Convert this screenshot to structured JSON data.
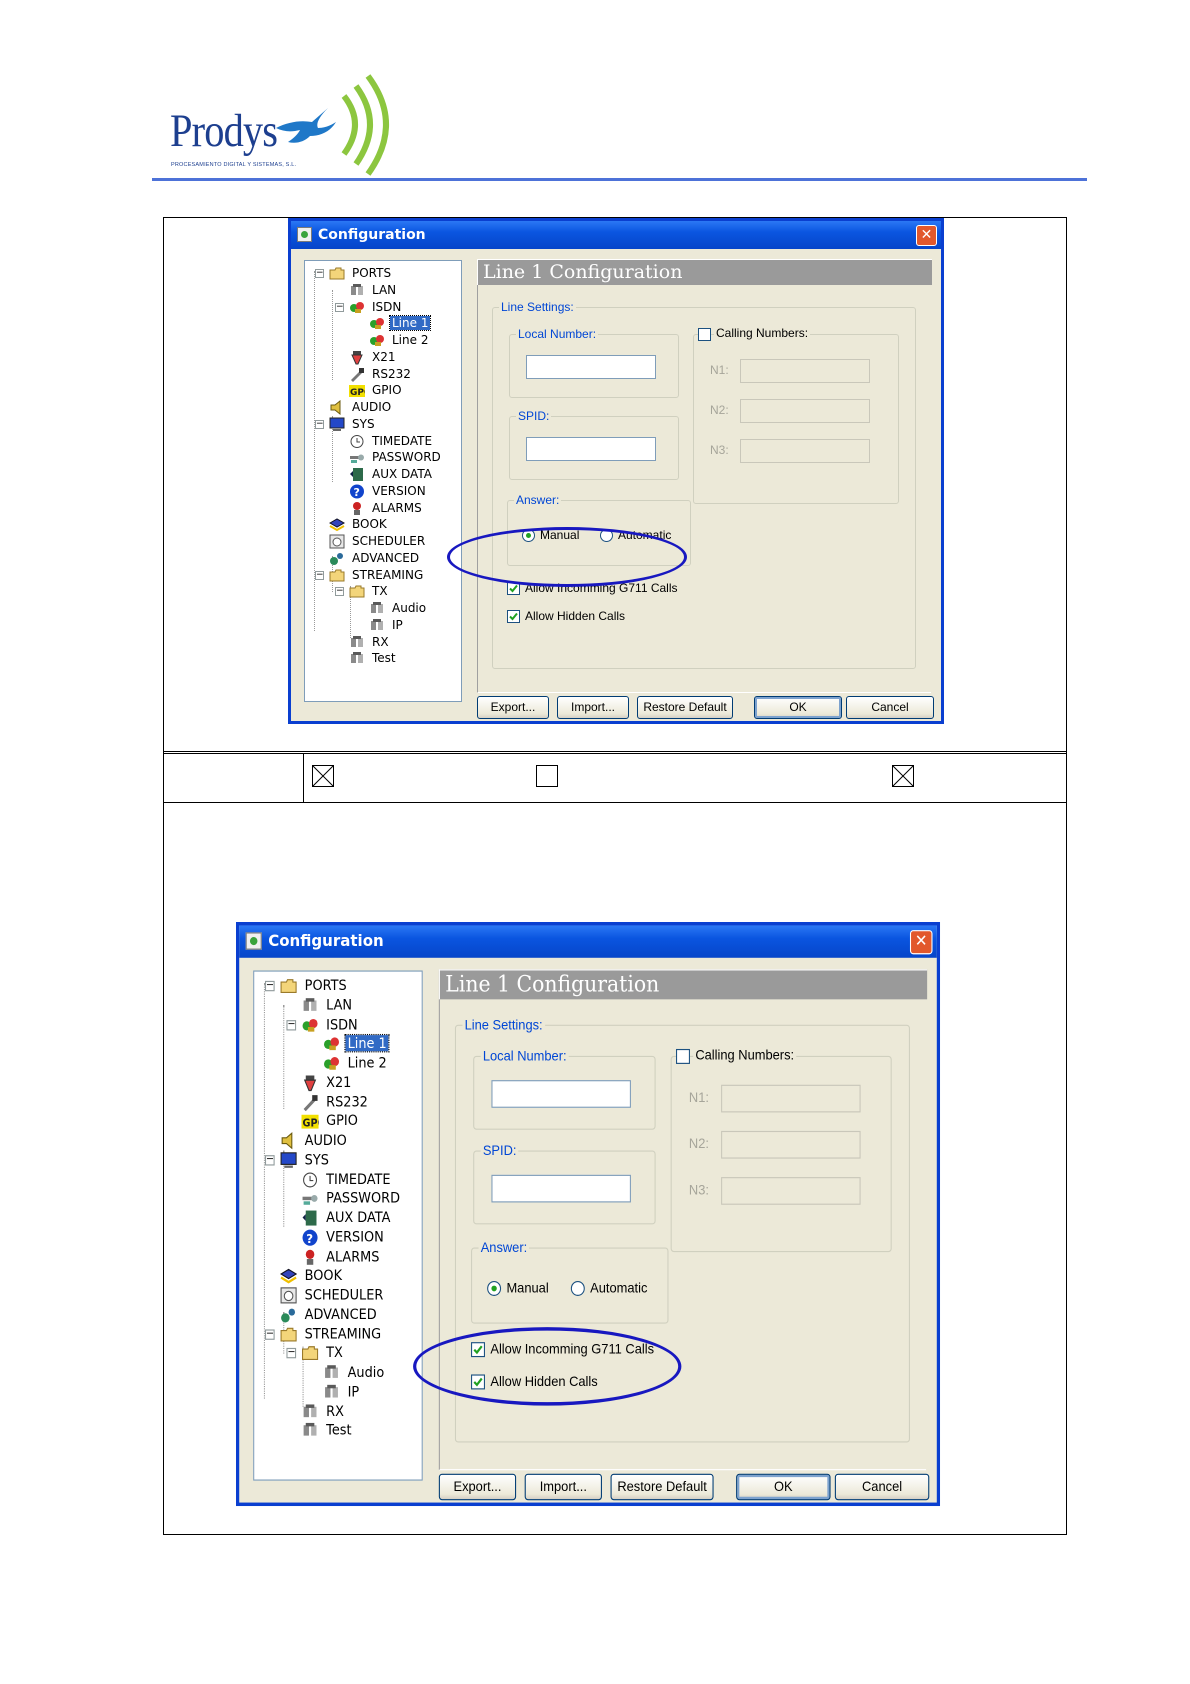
{
  "logo": {
    "name": "Prodys",
    "tagline": "PROCESAMIENTO DIGITAL Y SISTEMAS, S.L."
  },
  "colors": {
    "accent_rule": "#4d72d8",
    "title_bar": "#0a55e0",
    "highlight_ellipse": "#1818c0"
  },
  "checkbox_row": [
    {
      "checked": true
    },
    {
      "checked": false
    },
    {
      "checked": true
    }
  ],
  "dialog": {
    "title": "Configuration",
    "close_label": "✕",
    "tree": [
      {
        "label": "PORTS",
        "icon": "folder-icon"
      },
      {
        "label": "LAN",
        "icon": "network-icon"
      },
      {
        "label": "ISDN",
        "icon": "isdn-icon"
      },
      {
        "label": "Line 1",
        "icon": "line-icon"
      },
      {
        "label": "Line 2",
        "icon": "line-icon"
      },
      {
        "label": "X21",
        "icon": "x21-icon"
      },
      {
        "label": "RS232",
        "icon": "serial-icon"
      },
      {
        "label": "GPIO",
        "icon": "gpio-icon",
        "icon_text": "GPO"
      },
      {
        "label": "AUDIO",
        "icon": "speaker-icon"
      },
      {
        "label": "SYS",
        "icon": "computer-icon"
      },
      {
        "label": "TIMEDATE",
        "icon": "clock-icon"
      },
      {
        "label": "PASSWORD",
        "icon": "key-icon"
      },
      {
        "label": "AUX DATA",
        "icon": "data-icon"
      },
      {
        "label": "VERSION",
        "icon": "help-icon",
        "icon_text": "?"
      },
      {
        "label": "ALARMS",
        "icon": "alarm-icon"
      },
      {
        "label": "BOOK",
        "icon": "book-icon"
      },
      {
        "label": "SCHEDULER",
        "icon": "scheduler-icon"
      },
      {
        "label": "ADVANCED",
        "icon": "advanced-icon"
      },
      {
        "label": "STREAMING",
        "icon": "folder-icon"
      },
      {
        "label": "TX",
        "icon": "folder-icon"
      },
      {
        "label": "Audio",
        "icon": "network-icon"
      },
      {
        "label": "IP",
        "icon": "network-icon"
      },
      {
        "label": "RX",
        "icon": "network-icon"
      },
      {
        "label": "Test",
        "icon": "network-icon"
      }
    ],
    "selected_tree_item": "Line 1",
    "panel_title": "Line 1 Configuration",
    "line_settings_label": "Line Settings:",
    "local_number_label": "Local Number:",
    "local_number_value": "",
    "spid_label": "SPID:",
    "spid_value": "",
    "calling_numbers_label": "Calling Numbers:",
    "calling_numbers_checked": false,
    "n1_label": "N1:",
    "n2_label": "N2:",
    "n3_label": "N3:",
    "answer_label": "Answer:",
    "answer_options": [
      "Manual",
      "Automatic"
    ],
    "answer_selected": "Manual",
    "allow_g711_label": "Allow Incomming G711 Calls",
    "allow_hidden_label": "Allow Hidden Calls",
    "buttons": {
      "export": "Export...",
      "import": "Import...",
      "restore": "Restore Default",
      "ok": "OK",
      "cancel": "Cancel"
    }
  },
  "screenshots": [
    {
      "allow_g711_checked": true,
      "allow_hidden_checked": true,
      "highlight": "allow-incomming-g711-calls"
    },
    {
      "allow_g711_checked": true,
      "allow_hidden_checked": true,
      "highlight": "allow-hidden-calls"
    }
  ]
}
